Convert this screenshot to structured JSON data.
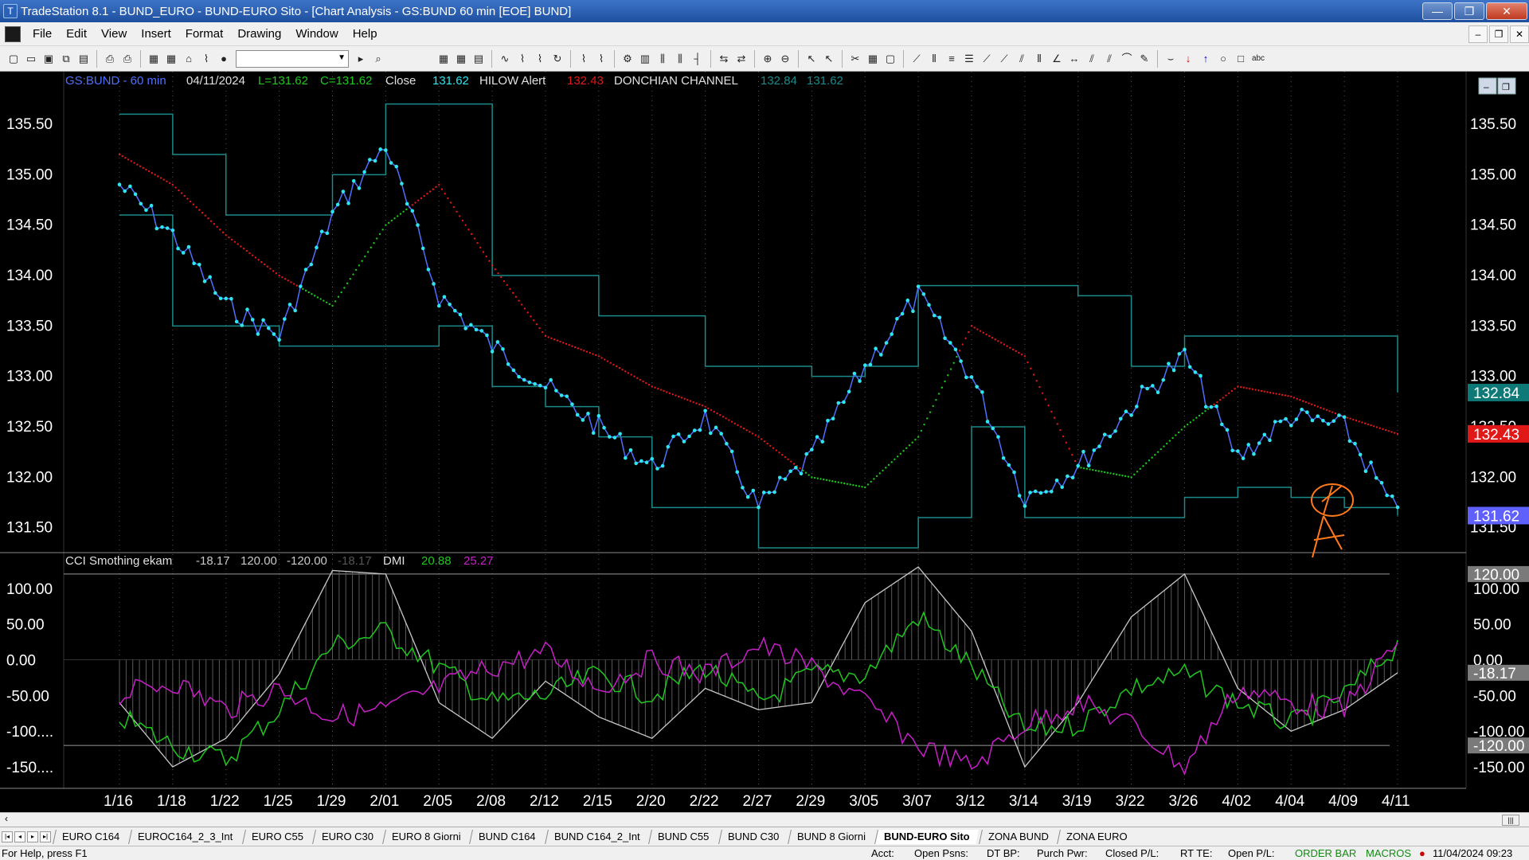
{
  "window": {
    "title": "TradeStation 8.1 - BUND_EURO - BUND-EURO Sito - [Chart Analysis - GS:BUND  60 min  [EOE] BUND]",
    "min_label": "—",
    "max_label": "❐",
    "close_label": "✕"
  },
  "menu": [
    "File",
    "Edit",
    "View",
    "Insert",
    "Format",
    "Drawing",
    "Window",
    "Help"
  ],
  "mdi_controls": [
    "–",
    "❐",
    "✕"
  ],
  "chart_header": {
    "symbol": "GS:BUND - 60 min",
    "date": "04/11/2024",
    "low": "L=131.62",
    "close_eq": "C=131.62",
    "close_label": "Close",
    "close_value": "131.62",
    "hilow_label": "HILOW Alert",
    "hilow_value": "132.43",
    "donchian_label": "DONCHIAN CHANNEL",
    "donchian_upper": "132.84",
    "donchian_lower": "131.62"
  },
  "sub_header": {
    "label": "CCI Smothing ekam",
    "v1": "-18.17",
    "v2": "120.00",
    "v3": "-120.00",
    "v4": "-18.17",
    "dmi_label": "DMI",
    "dmi_plus": "20.88",
    "dmi_minus": "25.27"
  },
  "price_axis": {
    "ticks": [
      "135.50",
      "135.00",
      "134.50",
      "134.00",
      "133.50",
      "133.00",
      "132.50",
      "132.00",
      "131.50"
    ],
    "marker_upper": "132.84",
    "marker_hilow": "132.43",
    "marker_last": "131.62"
  },
  "indicator_axis": {
    "ticks_left": [
      "100.00",
      "50.00",
      "0.00",
      "-50.00",
      "-100....",
      "-150...."
    ],
    "ticks_right": [
      "120.00",
      "100.00",
      "50.00",
      "0.00",
      "-18.17",
      "-50.00",
      "-100.00",
      "-120.00",
      "-150.00"
    ]
  },
  "time_axis": [
    "1/16",
    "1/18",
    "1/22",
    "1/25",
    "1/29",
    "2/01",
    "2/05",
    "2/08",
    "2/12",
    "2/15",
    "2/20",
    "2/22",
    "2/27",
    "2/29",
    "3/05",
    "3/07",
    "3/12",
    "3/14",
    "3/19",
    "3/22",
    "3/26",
    "4/02",
    "4/04",
    "4/09",
    "4/11"
  ],
  "chart_data": [
    {
      "type": "line",
      "name": "GS:BUND - 60 min",
      "x": [
        "1/16",
        "1/18",
        "1/22",
        "1/25",
        "1/29",
        "2/01",
        "2/05",
        "2/08",
        "2/12",
        "2/15",
        "2/20",
        "2/22",
        "2/27",
        "2/29",
        "3/05",
        "3/07",
        "3/12",
        "3/14",
        "3/19",
        "3/22",
        "3/26",
        "4/02",
        "4/04",
        "4/09",
        "4/11"
      ],
      "ylim": [
        131.3,
        135.8
      ],
      "series": [
        {
          "name": "Close",
          "values": [
            134.9,
            134.4,
            133.7,
            133.4,
            134.6,
            135.3,
            133.8,
            133.3,
            132.9,
            132.5,
            132.1,
            132.6,
            131.7,
            132.2,
            133.1,
            133.8,
            133.0,
            131.8,
            132.1,
            132.7,
            133.2,
            132.2,
            132.6,
            132.5,
            131.62
          ]
        },
        {
          "name": "HILOW Alert",
          "values": [
            135.2,
            134.9,
            134.4,
            134.0,
            133.7,
            134.5,
            134.9,
            134.1,
            133.4,
            133.2,
            132.9,
            132.7,
            132.4,
            132.0,
            131.9,
            132.4,
            133.5,
            133.2,
            132.1,
            132.0,
            132.5,
            132.9,
            132.8,
            132.6,
            132.43
          ]
        },
        {
          "name": "DONCHIAN CHANNEL upper",
          "values": [
            135.6,
            135.2,
            134.6,
            134.6,
            135.0,
            135.7,
            135.7,
            134.0,
            134.0,
            133.6,
            133.6,
            133.1,
            133.1,
            133.0,
            133.1,
            133.9,
            133.9,
            133.9,
            133.8,
            133.1,
            133.4,
            133.4,
            133.4,
            133.4,
            132.84
          ]
        },
        {
          "name": "DONCHIAN CHANNEL lower",
          "values": [
            134.6,
            133.5,
            133.5,
            133.3,
            133.3,
            133.3,
            133.5,
            132.9,
            132.7,
            132.4,
            131.7,
            131.7,
            131.3,
            131.3,
            131.3,
            131.6,
            132.5,
            131.6,
            131.6,
            131.6,
            131.8,
            131.9,
            131.8,
            131.7,
            131.62
          ]
        }
      ]
    },
    {
      "type": "line",
      "name": "CCI Smothing ekam / DMI",
      "x": [
        "1/16",
        "1/18",
        "1/22",
        "1/25",
        "1/29",
        "2/01",
        "2/05",
        "2/08",
        "2/12",
        "2/15",
        "2/20",
        "2/22",
        "2/27",
        "2/29",
        "3/05",
        "3/07",
        "3/12",
        "3/14",
        "3/19",
        "3/22",
        "3/26",
        "4/02",
        "4/04",
        "4/09",
        "4/11"
      ],
      "ylim": [
        -180,
        150
      ],
      "reference_lines": [
        120,
        0,
        -120
      ],
      "series": [
        {
          "name": "CCI Smothing ekam",
          "values": [
            -60,
            -150,
            -110,
            -20,
            125,
            120,
            -60,
            -110,
            -30,
            -80,
            -110,
            -40,
            -70,
            -60,
            80,
            130,
            40,
            -150,
            -60,
            60,
            120,
            -40,
            -100,
            -70,
            -18.17
          ]
        },
        {
          "name": "DMI",
          "values": [
            -80,
            -120,
            -140,
            -70,
            20,
            40,
            -10,
            -60,
            -50,
            -20,
            -50,
            -10,
            -60,
            -20,
            -20,
            60,
            -10,
            -100,
            -90,
            -40,
            -20,
            -60,
            -90,
            -50,
            20.88
          ]
        },
        {
          "name": "DMI",
          "values": [
            -50,
            -30,
            -70,
            -40,
            -80,
            -70,
            -40,
            -10,
            10,
            -40,
            0,
            -20,
            20,
            -10,
            -60,
            -120,
            -150,
            -90,
            -60,
            -90,
            -150,
            -40,
            -60,
            -70,
            25.27
          ]
        }
      ]
    }
  ],
  "tabs": [
    "EURO C164",
    "EUROC164_2_3_Int",
    "EURO C55",
    "EURO C30",
    "EURO 8 Giorni",
    "BUND C164",
    "BUND C164_2_Int",
    "BUND C55",
    "BUND  C30",
    "BUND 8 Giorni",
    "BUND-EURO Sito",
    "ZONA BUND",
    "ZONA EURO"
  ],
  "active_tab": "BUND-EURO Sito",
  "status": {
    "help": "For Help, press F1",
    "acct": "Acct:",
    "open_psns": "Open Psns:",
    "dt_bp": "DT BP:",
    "purch_pwr": "Purch Pwr:",
    "closed_pl": "Closed P/L:",
    "rt_te": "RT TE:",
    "open_pl": "Open P/L:",
    "order_bar": "ORDER BAR",
    "macros": "MACROS",
    "datetime": "11/04/2024 09:23"
  },
  "colors": {
    "price": "#4f6fff",
    "price_dots": "#2ee6f0",
    "donchian": "#1a8a8a",
    "hilow_up": "#19c819",
    "hilow_down": "#e01818",
    "cci": "#c8c8c8",
    "dmi_plus": "#1ec81e",
    "dmi_minus": "#c81ec8",
    "annotation": "#ff7a1a",
    "marker_upper_bg": "#0e7a78",
    "marker_hilow_bg": "#e01818",
    "marker_last_bg": "#6060ff"
  },
  "icons": [
    "new-icon",
    "open-icon",
    "save-icon",
    "print-icon",
    "zoom-in-icon",
    "zoom-out-icon",
    "cursor-icon",
    "trendline-icon",
    "text-icon"
  ]
}
